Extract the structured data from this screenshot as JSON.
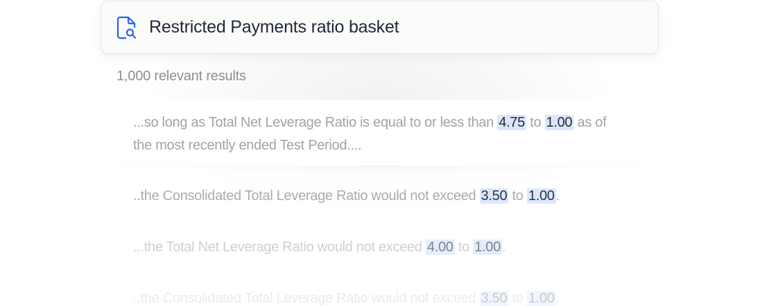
{
  "search": {
    "query": "Restricted Payments ratio basket",
    "icon": "document-search-icon",
    "icon_color": "#2563eb"
  },
  "results": {
    "count_label": "1,000 relevant results",
    "items": [
      {
        "before": "...so long as Total Net Leverage Ratio is equal to or less than ",
        "ratio_a": "4.75",
        "mid": " to ",
        "ratio_b": "1.00",
        "after": " as of the most recently ended Test Period...."
      },
      {
        "before": "..the Consolidated Total Leverage Ratio would not exceed ",
        "ratio_a": "3.50",
        "mid": " to ",
        "ratio_b": "1.00",
        "after": "."
      },
      {
        "before": "...the Total Net Leverage Ratio would not exceed ",
        "ratio_a": "4.00",
        "mid": " to ",
        "ratio_b": "1.00",
        "after": "."
      },
      {
        "before": "..the Consolidated Total Leverage Ratio would not exceed ",
        "ratio_a": "3.50",
        "mid": " to ",
        "ratio_b": "1.00",
        "after": "."
      }
    ]
  },
  "colors": {
    "highlight": "#dce6fb",
    "accent": "#2563eb"
  }
}
